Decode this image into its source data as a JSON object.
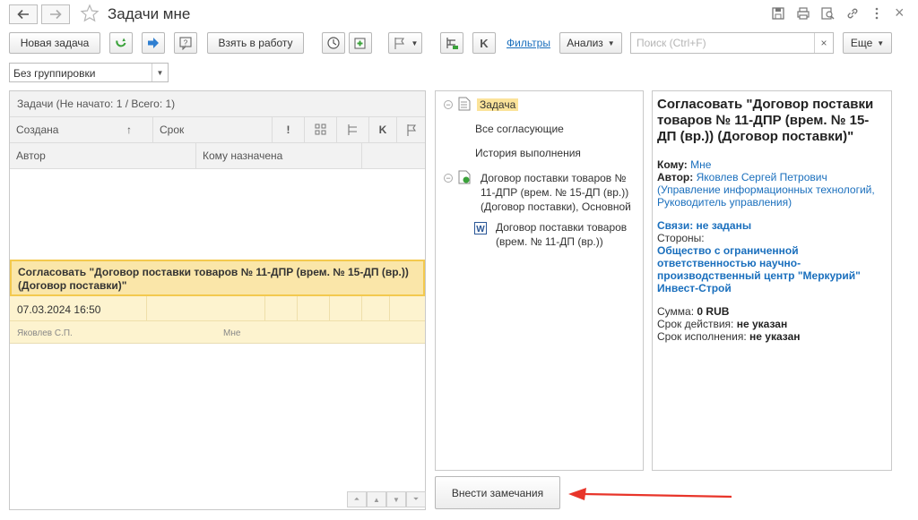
{
  "window": {
    "title": "Задачи мне",
    "icons": [
      "back-arrow-icon",
      "forward-arrow-icon",
      "star-icon",
      "save-icon",
      "print-icon",
      "preview-icon",
      "link-icon",
      "more-icon",
      "close-icon"
    ],
    "close_glyph": "×"
  },
  "toolbar": {
    "new_task": "Новая задача",
    "take_to_work": "Взять в работу",
    "filters": "Фильтры",
    "analysis": "Анализ",
    "search_placeholder": "Поиск (Ctrl+F)",
    "search_clear": "×",
    "more": "Еще",
    "k_label": "K"
  },
  "grouping": {
    "value": "Без группировки"
  },
  "task_list": {
    "caption": "Задачи (Не начато: 1 / Всего: 1)",
    "columns_row1": {
      "created": "Создана",
      "sort_indicator": "↑",
      "deadline": "Срок",
      "importance": "!",
      "k": "K"
    },
    "columns_row2": {
      "author": "Автор",
      "assignee": "Кому назначена"
    },
    "rows": [
      {
        "title": "Согласовать \"Договор поставки товаров  № 11-ДПР (врем. № 15-ДП (вр.)) (Договор поставки)\"",
        "created": "07.03.2024 16:50",
        "author": "Яковлев С.П.",
        "assignee": "Мне"
      }
    ]
  },
  "tree": {
    "items": [
      {
        "label": "Задача",
        "selected": true,
        "toggle": "−"
      },
      {
        "label": "Все согласующие"
      },
      {
        "label": "История выполнения"
      },
      {
        "label": "Договор поставки товаров  № 11-ДПР (врем. № 15-ДП (вр.)) (Договор поставки), Основной",
        "toggle": "−"
      },
      {
        "label": "Договор поставки товаров (врем. № 11-ДП (вр.))"
      }
    ]
  },
  "details": {
    "title": "Согласовать \"Договор поставки товаров  № 11-ДПР (врем. № 15-ДП (вр.)) (Договор поставки)\"",
    "to_label": "Кому:",
    "to_value": "Мне",
    "author_label": "Автор:",
    "author_value": "Яковлев Сергей Петрович (Управление информационных технологий, Руководитель управления)",
    "links_label": "Связи: не заданы",
    "parties_label": "Стороны:",
    "parties_value": "Общество с ограниченной ответственностью научно-производственный центр \"Меркурий\" Инвест-Строй",
    "sum_label": "Сумма:",
    "sum_value": "0 RUB",
    "validity_label": "Срок действия:",
    "validity_value": "не указан",
    "execution_label": "Срок исполнения:",
    "execution_value": "не указан"
  },
  "actions": {
    "make_remarks": "Внести замечания"
  },
  "colors": {
    "accent_link": "#1a6fbd",
    "selection": "#fae6a9",
    "selection_border": "#f3c94e",
    "annotation_arrow": "#e8352a",
    "refresh_green": "#3aa23a",
    "arrow_blue": "#2f7fd1"
  }
}
